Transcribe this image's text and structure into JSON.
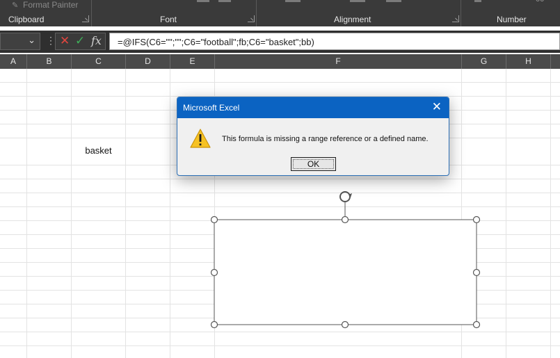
{
  "ribbon": {
    "format_painter_label": "Format Painter",
    "groups": {
      "clipboard": "Clipboard",
      "font": "Font",
      "alignment": "Alignment",
      "number": "Number"
    },
    "number_fragment": "00"
  },
  "formula_bar": {
    "name_box_value": "",
    "formula": "=@IFS(C6=\"\";\"\";C6=\"football\";fb;C6=\"basket\";bb)",
    "fx_label": "fx"
  },
  "columns": [
    "A",
    "B",
    "C",
    "D",
    "E",
    "F",
    "G",
    "H"
  ],
  "cells": {
    "C6": "basket"
  },
  "dialog": {
    "title": "Microsoft Excel",
    "message": "This formula is missing a range reference or a defined name.",
    "ok_label": "OK"
  },
  "icons": {
    "cancel": "close-x-icon",
    "enter": "checkmark-icon",
    "warning": "warning-triangle-icon",
    "rotate": "rotate-handle-icon"
  },
  "colors": {
    "dialog_titlebar": "#0b63c2",
    "cancel_red": "#e0463f",
    "enter_green": "#3fae59",
    "warning_yellow": "#f6c223"
  }
}
